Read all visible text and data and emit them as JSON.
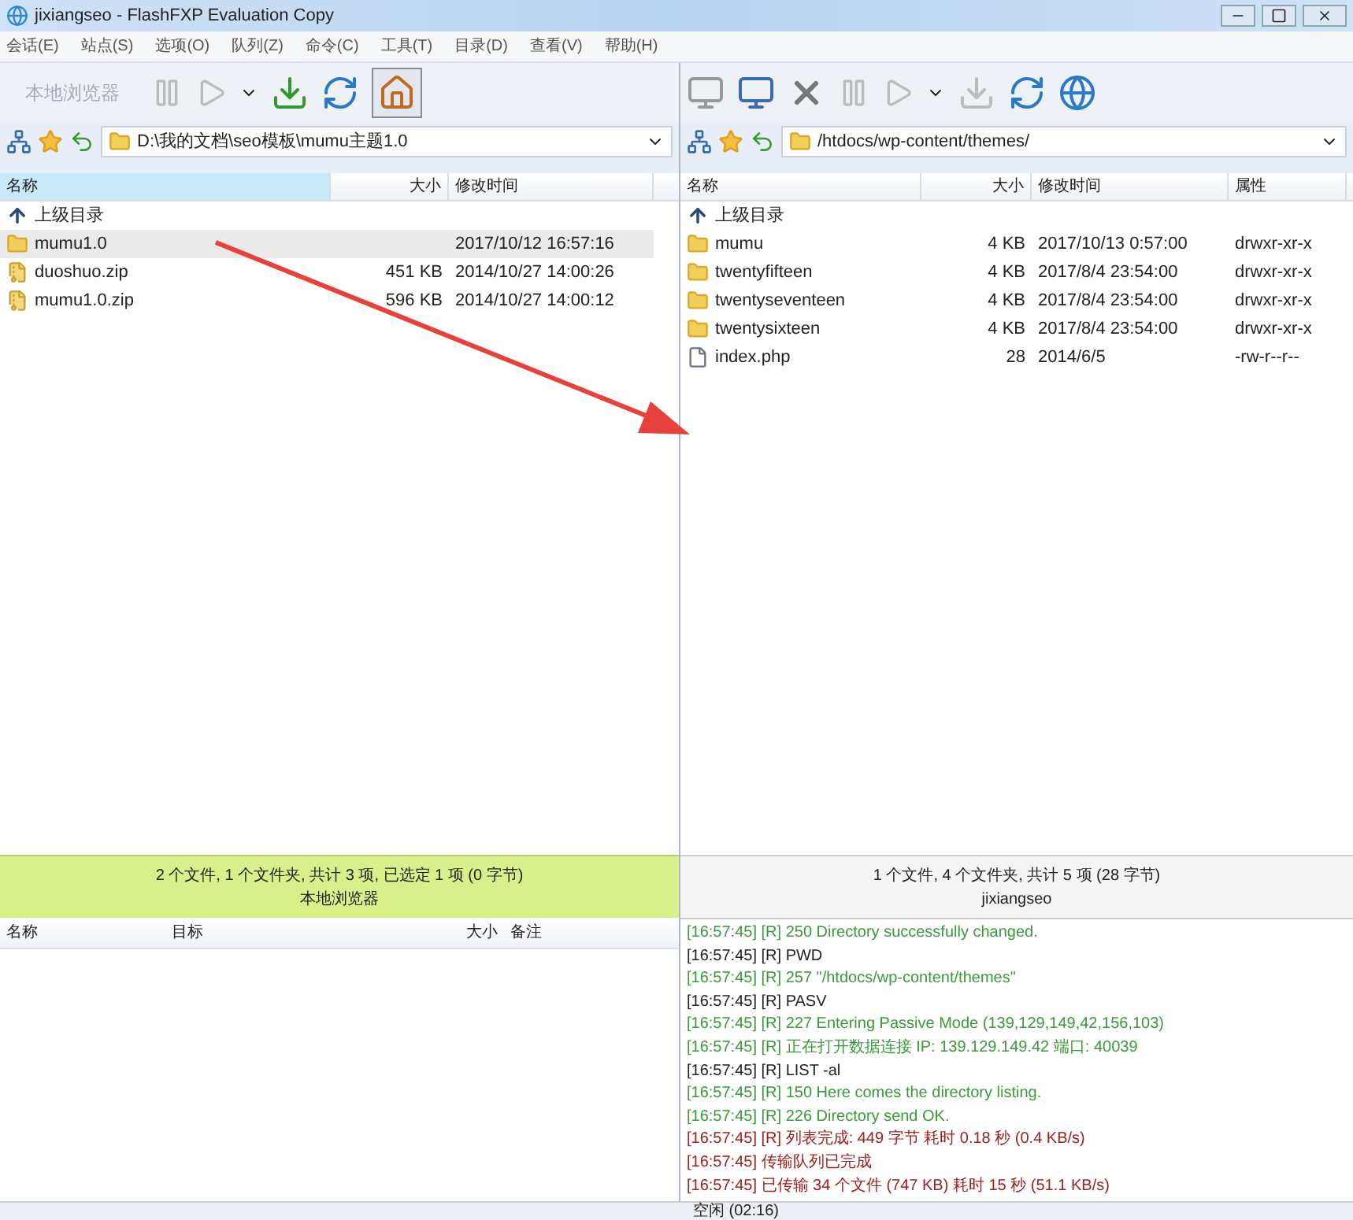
{
  "window": {
    "title": "jixiangseo - FlashFXP Evaluation Copy"
  },
  "menu": [
    "会话(E)",
    "站点(S)",
    "选项(O)",
    "队列(Z)",
    "命令(C)",
    "工具(T)",
    "目录(D)",
    "查看(V)",
    "帮助(H)"
  ],
  "local": {
    "toolbar_button": {
      "label": "本地浏览器",
      "disabled": true
    },
    "path": "D:\\我的文档\\seo模板\\mumu主题1.0",
    "columns": [
      "名称",
      "大小",
      "修改时间"
    ],
    "rows": [
      {
        "kind": "up",
        "name": "上级目录",
        "selected": false
      },
      {
        "kind": "folder",
        "name": "mumu1.0",
        "size": "",
        "modified": "2017/10/12 16:57:16",
        "selected": true
      },
      {
        "kind": "archive",
        "name": "duoshuo.zip",
        "size": "451 KB",
        "modified": "2014/10/27 14:00:26",
        "selected": false
      },
      {
        "kind": "archive",
        "name": "mumu1.0.zip",
        "size": "596 KB",
        "modified": "2014/10/27 14:00:12",
        "selected": false
      }
    ],
    "summary": "2 个文件, 1 个文件夹, 共计 3 项, 已选定 1 项 (0 字节)",
    "caption": "本地浏览器"
  },
  "remote": {
    "path": "/htdocs/wp-content/themes/",
    "columns": [
      "名称",
      "大小",
      "修改时间",
      "属性"
    ],
    "rows": [
      {
        "kind": "up",
        "name": "上级目录"
      },
      {
        "kind": "folder",
        "name": "mumu",
        "size": "4 KB",
        "modified": "2017/10/13 0:57:00",
        "attributes": "drwxr-xr-x"
      },
      {
        "kind": "folder",
        "name": "twentyfifteen",
        "size": "4 KB",
        "modified": "2017/8/4 23:54:00",
        "attributes": "drwxr-xr-x"
      },
      {
        "kind": "folder",
        "name": "twentyseventeen",
        "size": "4 KB",
        "modified": "2017/8/4 23:54:00",
        "attributes": "drwxr-xr-x"
      },
      {
        "kind": "folder",
        "name": "twentysixteen",
        "size": "4 KB",
        "modified": "2017/8/4 23:54:00",
        "attributes": "drwxr-xr-x"
      },
      {
        "kind": "file",
        "name": "index.php",
        "size": "28",
        "modified": "2014/6/5",
        "attributes": "-rw-r--r--"
      }
    ],
    "summary": "1 个文件, 4 个文件夹, 共计 5 项 (28 字节)",
    "caption": "jixiangseo"
  },
  "queue": {
    "columns": [
      "名称",
      "目标",
      "大小",
      "备注"
    ]
  },
  "log": [
    {
      "text": "[16:57:45] [R] 250 Directory successfully changed.",
      "color": "#3a9a3a"
    },
    {
      "text": "[16:57:45] [R] PWD",
      "color": "#222222"
    },
    {
      "text": "[16:57:45] [R] 257 \"/htdocs/wp-content/themes\"",
      "color": "#3a9a3a"
    },
    {
      "text": "[16:57:45] [R] PASV",
      "color": "#222222"
    },
    {
      "text": "[16:57:45] [R] 227 Entering Passive Mode (139,129,149,42,156,103)",
      "color": "#3a9a3a"
    },
    {
      "text": "[16:57:45] [R] 正在打开数据连接 IP: 139.129.149.42 端口: 40039",
      "color": "#3a9a3a"
    },
    {
      "text": "[16:57:45] [R] LIST -al",
      "color": "#222222"
    },
    {
      "text": "[16:57:45] [R] 150 Here comes the directory listing.",
      "color": "#3a9a3a"
    },
    {
      "text": "[16:57:45] [R] 226 Directory send OK.",
      "color": "#3a9a3a"
    },
    {
      "text": "[16:57:45] [R] 列表完成: 449 字节 耗时 0.18 秒 (0.4 KB/s)",
      "color": "#a02020"
    },
    {
      "text": "[16:57:45] 传输队列已完成",
      "color": "#a02020"
    },
    {
      "text": "[16:57:45] 已传输 34 个文件 (747 KB) 耗时 15 秒 (51.1 KB/s)",
      "color": "#a02020"
    }
  ],
  "status_bar": "空闲 (02:16)"
}
